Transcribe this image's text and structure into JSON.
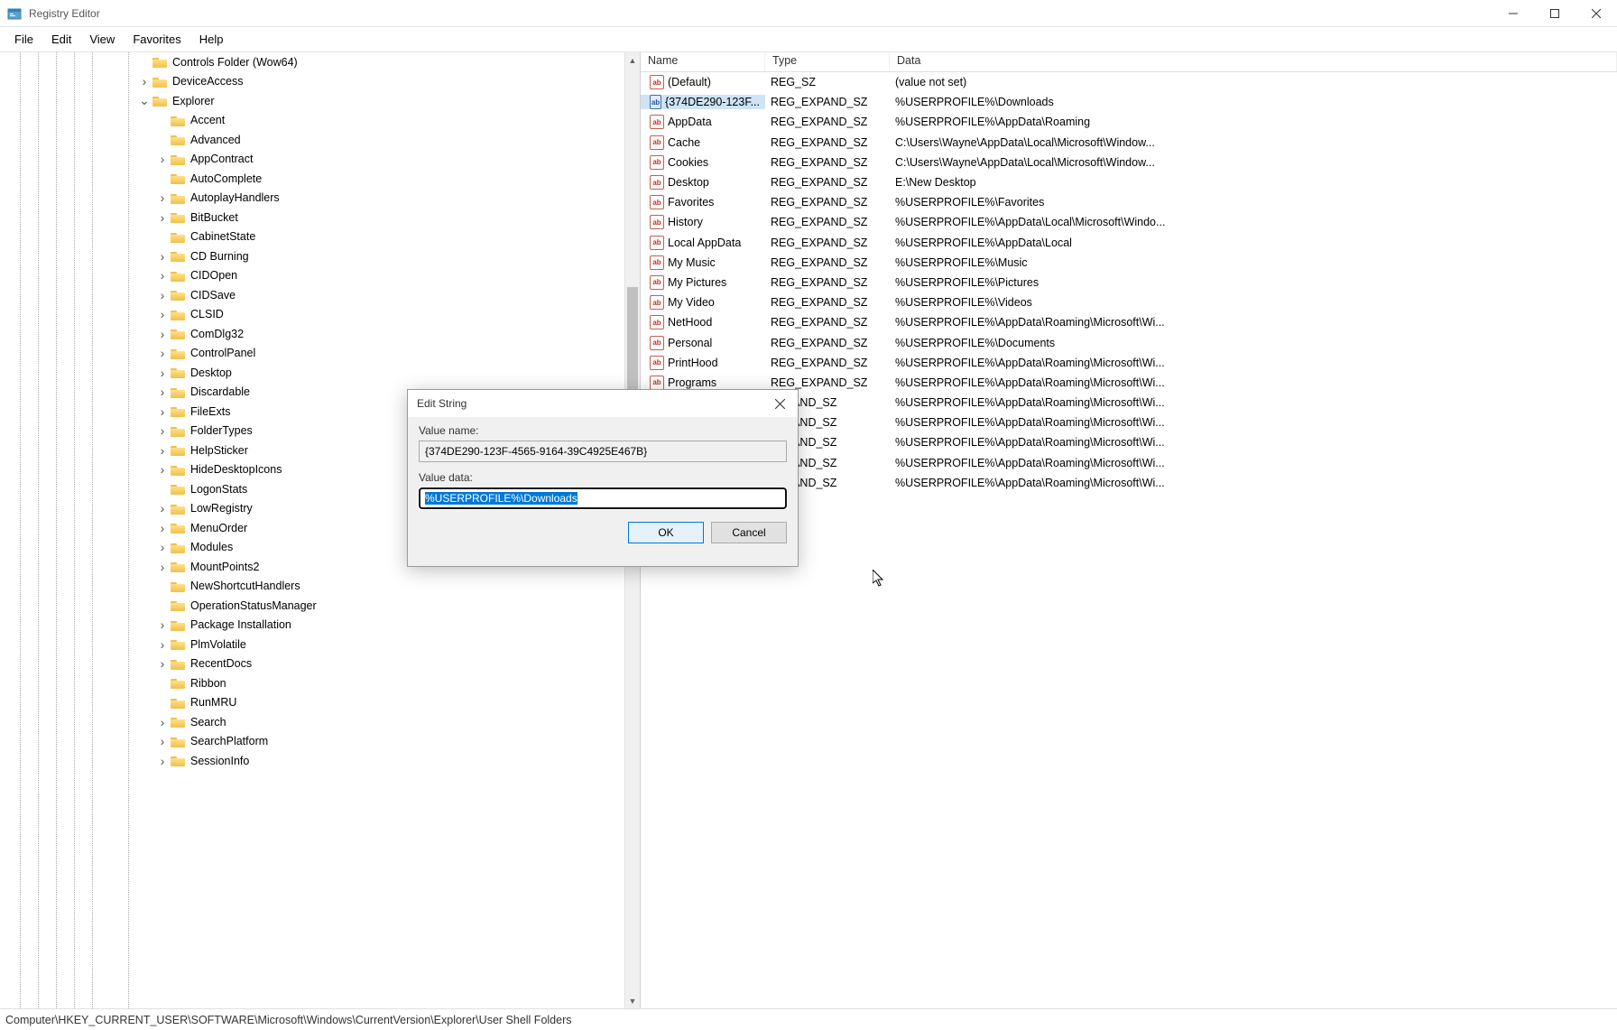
{
  "window": {
    "title": "Registry Editor"
  },
  "menu": {
    "file": "File",
    "edit": "Edit",
    "view": "View",
    "favorites": "Favorites",
    "help": "Help"
  },
  "tree": {
    "top": {
      "label": "Controls Folder (Wow64)",
      "indent": 153,
      "expander": ""
    },
    "items": [
      {
        "label": "DeviceAccess",
        "indent": 153,
        "expander": "▶"
      },
      {
        "label": "Explorer",
        "indent": 153,
        "expander": "▼"
      },
      {
        "label": "Accent",
        "indent": 173,
        "expander": ""
      },
      {
        "label": "Advanced",
        "indent": 173,
        "expander": ""
      },
      {
        "label": "AppContract",
        "indent": 173,
        "expander": "▶"
      },
      {
        "label": "AutoComplete",
        "indent": 173,
        "expander": ""
      },
      {
        "label": "AutoplayHandlers",
        "indent": 173,
        "expander": "▶"
      },
      {
        "label": "BitBucket",
        "indent": 173,
        "expander": "▶"
      },
      {
        "label": "CabinetState",
        "indent": 173,
        "expander": ""
      },
      {
        "label": "CD Burning",
        "indent": 173,
        "expander": "▶"
      },
      {
        "label": "CIDOpen",
        "indent": 173,
        "expander": "▶"
      },
      {
        "label": "CIDSave",
        "indent": 173,
        "expander": "▶"
      },
      {
        "label": "CLSID",
        "indent": 173,
        "expander": "▶"
      },
      {
        "label": "ComDlg32",
        "indent": 173,
        "expander": "▶"
      },
      {
        "label": "ControlPanel",
        "indent": 173,
        "expander": "▶"
      },
      {
        "label": "Desktop",
        "indent": 173,
        "expander": "▶"
      },
      {
        "label": "Discardable",
        "indent": 173,
        "expander": "▶"
      },
      {
        "label": "FileExts",
        "indent": 173,
        "expander": "▶"
      },
      {
        "label": "FolderTypes",
        "indent": 173,
        "expander": "▶"
      },
      {
        "label": "HelpSticker",
        "indent": 173,
        "expander": "▶"
      },
      {
        "label": "HideDesktopIcons",
        "indent": 173,
        "expander": "▶"
      },
      {
        "label": "LogonStats",
        "indent": 173,
        "expander": ""
      },
      {
        "label": "LowRegistry",
        "indent": 173,
        "expander": "▶"
      },
      {
        "label": "MenuOrder",
        "indent": 173,
        "expander": "▶"
      },
      {
        "label": "Modules",
        "indent": 173,
        "expander": "▶"
      },
      {
        "label": "MountPoints2",
        "indent": 173,
        "expander": "▶"
      },
      {
        "label": "NewShortcutHandlers",
        "indent": 173,
        "expander": ""
      },
      {
        "label": "OperationStatusManager",
        "indent": 173,
        "expander": ""
      },
      {
        "label": "Package Installation",
        "indent": 173,
        "expander": "▶"
      },
      {
        "label": "PlmVolatile",
        "indent": 173,
        "expander": "▶"
      },
      {
        "label": "RecentDocs",
        "indent": 173,
        "expander": "▶"
      },
      {
        "label": "Ribbon",
        "indent": 173,
        "expander": ""
      },
      {
        "label": "RunMRU",
        "indent": 173,
        "expander": ""
      },
      {
        "label": "Search",
        "indent": 173,
        "expander": "▶"
      },
      {
        "label": "SearchPlatform",
        "indent": 173,
        "expander": "▶"
      },
      {
        "label": "SessionInfo",
        "indent": 173,
        "expander": "▶"
      }
    ]
  },
  "list": {
    "headers": {
      "name": "Name",
      "type": "Type",
      "data": "Data"
    },
    "rows": [
      {
        "name": "(Default)",
        "type": "REG_SZ",
        "data": "(value not set)",
        "selected": false
      },
      {
        "name": "{374DE290-123F...",
        "type": "REG_EXPAND_SZ",
        "data": "%USERPROFILE%\\Downloads",
        "selected": true
      },
      {
        "name": "AppData",
        "type": "REG_EXPAND_SZ",
        "data": "%USERPROFILE%\\AppData\\Roaming",
        "selected": false
      },
      {
        "name": "Cache",
        "type": "REG_EXPAND_SZ",
        "data": "C:\\Users\\Wayne\\AppData\\Local\\Microsoft\\Window...",
        "selected": false
      },
      {
        "name": "Cookies",
        "type": "REG_EXPAND_SZ",
        "data": "C:\\Users\\Wayne\\AppData\\Local\\Microsoft\\Window...",
        "selected": false
      },
      {
        "name": "Desktop",
        "type": "REG_EXPAND_SZ",
        "data": "E:\\New Desktop",
        "selected": false
      },
      {
        "name": "Favorites",
        "type": "REG_EXPAND_SZ",
        "data": "%USERPROFILE%\\Favorites",
        "selected": false
      },
      {
        "name": "History",
        "type": "REG_EXPAND_SZ",
        "data": "%USERPROFILE%\\AppData\\Local\\Microsoft\\Windo...",
        "selected": false
      },
      {
        "name": "Local AppData",
        "type": "REG_EXPAND_SZ",
        "data": "%USERPROFILE%\\AppData\\Local",
        "selected": false
      },
      {
        "name": "My Music",
        "type": "REG_EXPAND_SZ",
        "data": "%USERPROFILE%\\Music",
        "selected": false
      },
      {
        "name": "My Pictures",
        "type": "REG_EXPAND_SZ",
        "data": "%USERPROFILE%\\Pictures",
        "selected": false
      },
      {
        "name": "My Video",
        "type": "REG_EXPAND_SZ",
        "data": "%USERPROFILE%\\Videos",
        "selected": false
      },
      {
        "name": "NetHood",
        "type": "REG_EXPAND_SZ",
        "data": "%USERPROFILE%\\AppData\\Roaming\\Microsoft\\Wi...",
        "selected": false
      },
      {
        "name": "Personal",
        "type": "REG_EXPAND_SZ",
        "data": "%USERPROFILE%\\Documents",
        "selected": false
      },
      {
        "name": "PrintHood",
        "type": "REG_EXPAND_SZ",
        "data": "%USERPROFILE%\\AppData\\Roaming\\Microsoft\\Wi...",
        "selected": false
      },
      {
        "name": "Programs",
        "type": "REG_EXPAND_SZ",
        "data": "%USERPROFILE%\\AppData\\Roaming\\Microsoft\\Wi...",
        "selected": false
      },
      {
        "name": "",
        "type": "EXPAND_SZ",
        "data": "%USERPROFILE%\\AppData\\Roaming\\Microsoft\\Wi...",
        "selected": false,
        "obscured": true
      },
      {
        "name": "",
        "type": "EXPAND_SZ",
        "data": "%USERPROFILE%\\AppData\\Roaming\\Microsoft\\Wi...",
        "selected": false,
        "obscured": true
      },
      {
        "name": "",
        "type": "EXPAND_SZ",
        "data": "%USERPROFILE%\\AppData\\Roaming\\Microsoft\\Wi...",
        "selected": false,
        "obscured": true
      },
      {
        "name": "",
        "type": "EXPAND_SZ",
        "data": "%USERPROFILE%\\AppData\\Roaming\\Microsoft\\Wi...",
        "selected": false,
        "obscured": true
      },
      {
        "name": "",
        "type": "EXPAND_SZ",
        "data": "%USERPROFILE%\\AppData\\Roaming\\Microsoft\\Wi...",
        "selected": false,
        "obscured": true
      }
    ]
  },
  "status": {
    "path": "Computer\\HKEY_CURRENT_USER\\SOFTWARE\\Microsoft\\Windows\\CurrentVersion\\Explorer\\User Shell Folders"
  },
  "dialog": {
    "title": "Edit String",
    "valueNameLabel": "Value name:",
    "valueName": "{374DE290-123F-4565-9164-39C4925E467B}",
    "valueDataLabel": "Value data:",
    "valueData": "%USERPROFILE%\\Downloads",
    "ok": "OK",
    "cancel": "Cancel"
  }
}
